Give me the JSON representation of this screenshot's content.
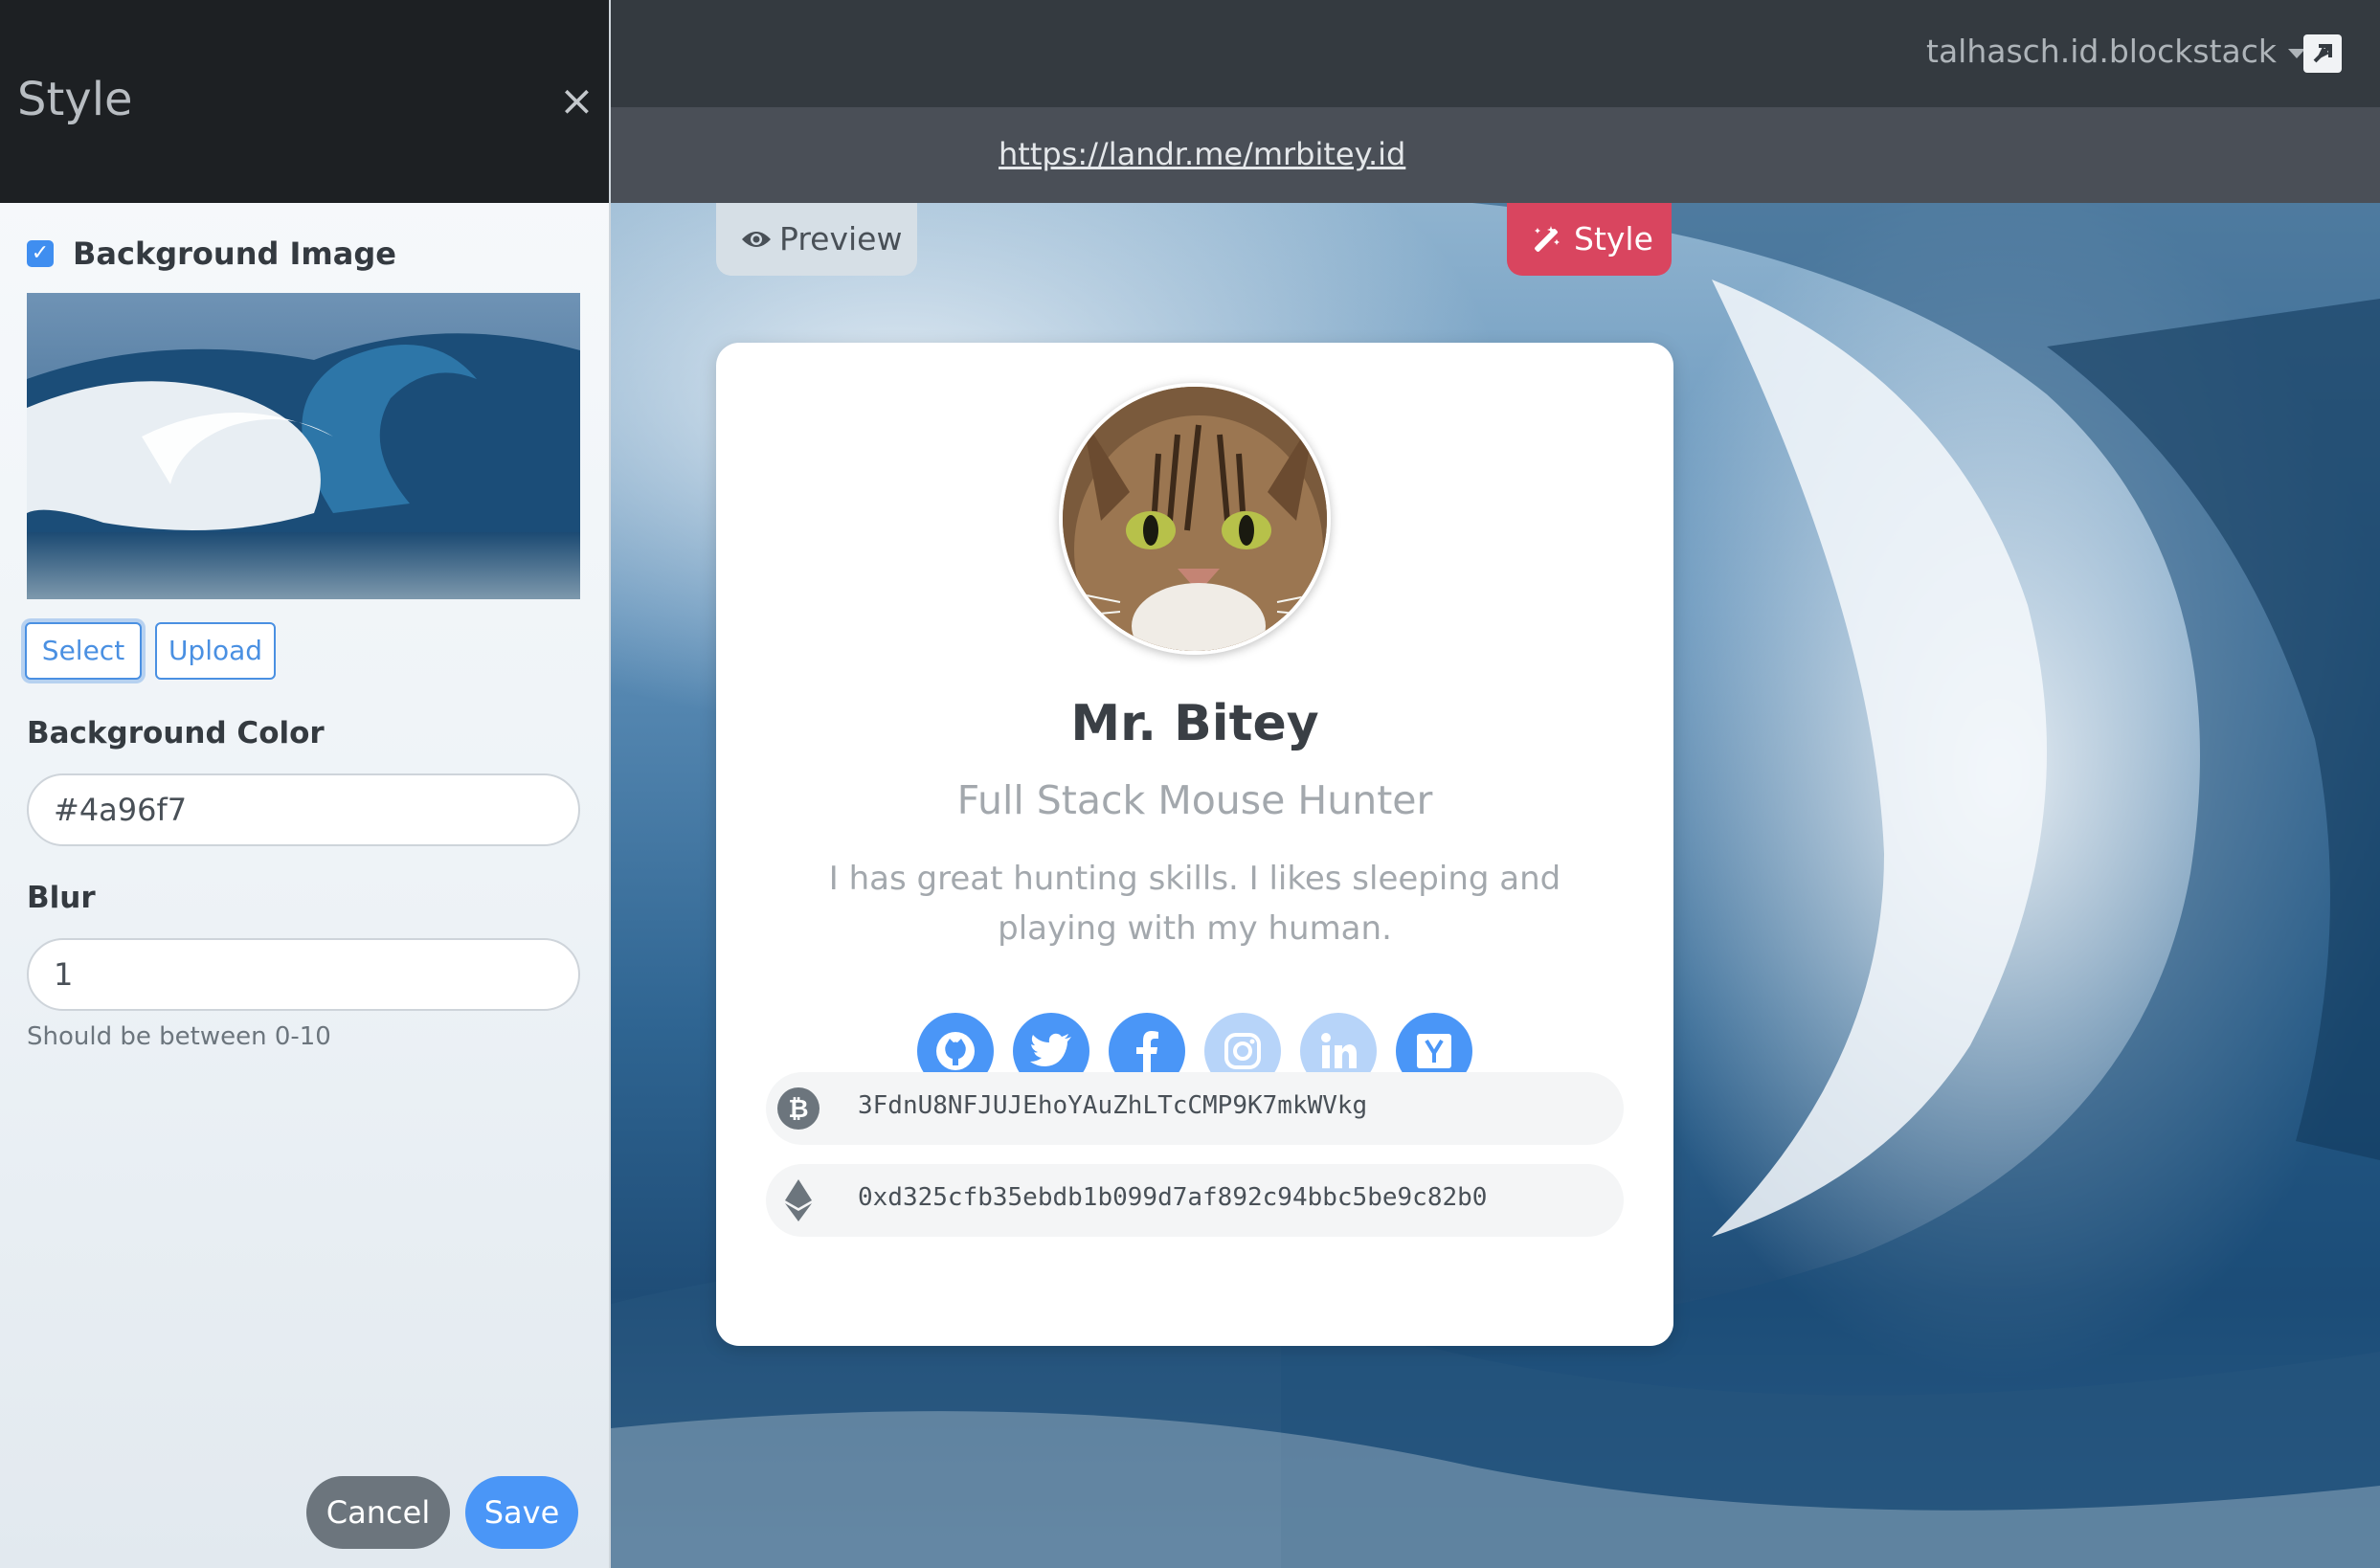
{
  "panel": {
    "title": "Style",
    "close_glyph": "×",
    "background_image": {
      "label": "Background Image",
      "checked": true,
      "select_label": "Select",
      "upload_label": "Upload"
    },
    "background_color": {
      "label": "Background Color",
      "value": "#4a96f7"
    },
    "blur": {
      "label": "Blur",
      "value": "1",
      "help": "Should be between 0-10"
    },
    "cancel_label": "Cancel",
    "save_label": "Save"
  },
  "topbar": {
    "user": "talhasch.id.blockstack",
    "external_icon": "external-link-icon"
  },
  "urlbar": {
    "url": "https://landr.me/mrbitey.id"
  },
  "tabs": {
    "preview_label": "Preview",
    "preview_icon": "eye-icon",
    "style_label": "Style",
    "style_icon": "magic-wand-icon"
  },
  "profile": {
    "name": "Mr. Bitey",
    "title": "Full Stack Mouse Hunter",
    "bio": "I has great hunting skills. I likes sleeping and playing with my human.",
    "socials": [
      {
        "icon": "github-icon",
        "color": "#4a96f7",
        "active": true
      },
      {
        "icon": "twitter-icon",
        "color": "#4a96f7",
        "active": true
      },
      {
        "icon": "facebook-icon",
        "color": "#4a96f7",
        "active": true
      },
      {
        "icon": "instagram-icon",
        "color": "#b7d4f9",
        "active": false
      },
      {
        "icon": "linkedin-icon",
        "color": "#b7d4f9",
        "active": false
      },
      {
        "icon": "hacker-news-icon",
        "color": "#4a96f7",
        "active": true
      }
    ],
    "wallets": [
      {
        "icon": "bitcoin-icon",
        "address": "3FdnU8NFJUJEhoYAuZhLTcCMP9K7mkWVkg"
      },
      {
        "icon": "ethereum-icon",
        "address": "0xd325cfb35ebdb1b099d7af892c94bbc5be9c82b0"
      }
    ]
  },
  "colors": {
    "accent": "#4a96f7",
    "style_tab": "#d9455f",
    "panel_header": "#1d2023",
    "topbar": "#343a40",
    "urlbar": "#4a4f57"
  }
}
